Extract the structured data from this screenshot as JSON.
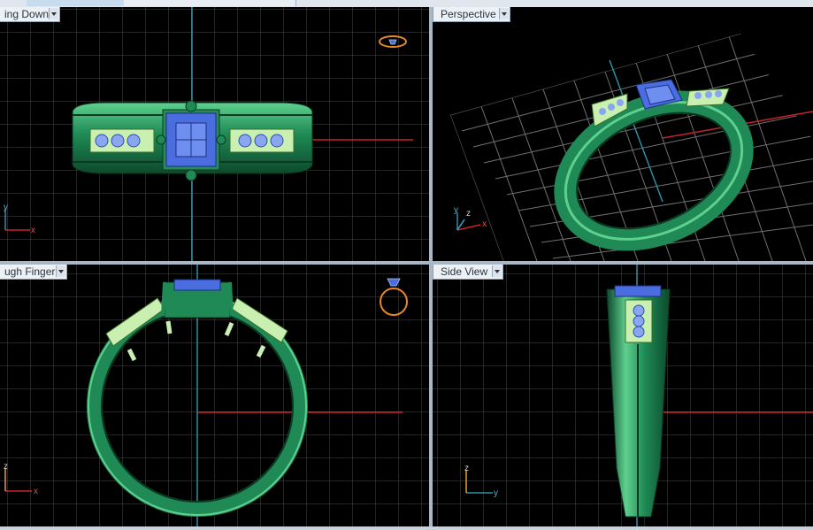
{
  "viewports": {
    "top_left": {
      "label": "ing Down"
    },
    "top_right": {
      "label": "Perspective"
    },
    "bottom_left": {
      "label": "ugh Finger"
    },
    "bottom_right": {
      "label": "Side View"
    }
  },
  "axes": {
    "x": "x",
    "y": "y",
    "z": "z"
  },
  "icons": [
    "dropdown-arrow-icon",
    "ring-gem-icon",
    "axis-gizmo-icon"
  ],
  "colors": {
    "background": "#000000",
    "grid": "#4a4a4a",
    "x_axis": "#c8232b",
    "y_axis": "#2f8fa3",
    "ring_metal": "#1f8a55",
    "gem": "#4a6ee0",
    "pave_plate": "#c9f0b0",
    "gizmo_orange": "#e6882a"
  }
}
